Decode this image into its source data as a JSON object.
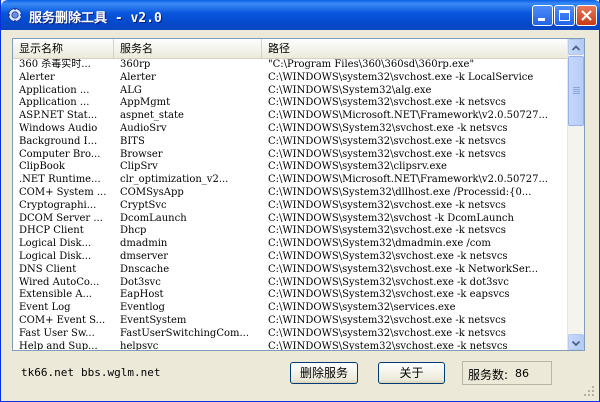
{
  "window": {
    "title": "服务删除工具 - v2.0"
  },
  "columns": [
    "显示名称",
    "服务名",
    "路径"
  ],
  "rows": [
    {
      "display": "360 杀毒实时...",
      "service": "360rp",
      "path": "\"C:\\Program Files\\360\\360sd\\360rp.exe\""
    },
    {
      "display": "Alerter",
      "service": "Alerter",
      "path": "C:\\WINDOWS\\system32\\svchost.exe -k LocalService"
    },
    {
      "display": "Application ...",
      "service": "ALG",
      "path": "C:\\WINDOWS\\System32\\alg.exe"
    },
    {
      "display": "Application ...",
      "service": "AppMgmt",
      "path": "C:\\WINDOWS\\system32\\svchost.exe -k netsvcs"
    },
    {
      "display": "ASP.NET Stat...",
      "service": "aspnet_state",
      "path": "C:\\WINDOWS\\Microsoft.NET\\Framework\\v2.0.50727..."
    },
    {
      "display": "Windows Audio",
      "service": "AudioSrv",
      "path": "C:\\WINDOWS\\System32\\svchost.exe -k netsvcs"
    },
    {
      "display": "Background I...",
      "service": "BITS",
      "path": "C:\\WINDOWS\\system32\\svchost.exe -k netsvcs"
    },
    {
      "display": "Computer Bro...",
      "service": "Browser",
      "path": "C:\\WINDOWS\\system32\\svchost.exe -k netsvcs"
    },
    {
      "display": "ClipBook",
      "service": "ClipSrv",
      "path": "C:\\WINDOWS\\system32\\clipsrv.exe"
    },
    {
      "display": ".NET Runtime...",
      "service": "clr_optimization_v2...",
      "path": "C:\\WINDOWS\\Microsoft.NET\\Framework\\v2.0.50727..."
    },
    {
      "display": "COM+ System ...",
      "service": "COMSysApp",
      "path": "C:\\WINDOWS\\System32\\dllhost.exe /Processid:{0..."
    },
    {
      "display": "Cryptographi...",
      "service": "CryptSvc",
      "path": "C:\\WINDOWS\\system32\\svchost.exe -k netsvcs"
    },
    {
      "display": "DCOM Server ...",
      "service": "DcomLaunch",
      "path": "C:\\WINDOWS\\system32\\svchost -k DcomLaunch"
    },
    {
      "display": "DHCP Client",
      "service": "Dhcp",
      "path": "C:\\WINDOWS\\system32\\svchost.exe -k netsvcs"
    },
    {
      "display": "Logical Disk...",
      "service": "dmadmin",
      "path": "C:\\WINDOWS\\System32\\dmadmin.exe /com"
    },
    {
      "display": "Logical Disk...",
      "service": "dmserver",
      "path": "C:\\WINDOWS\\System32\\svchost.exe -k netsvcs"
    },
    {
      "display": "DNS Client",
      "service": "Dnscache",
      "path": "C:\\WINDOWS\\system32\\svchost.exe -k NetworkSer..."
    },
    {
      "display": "Wired AutoCo...",
      "service": "Dot3svc",
      "path": "C:\\WINDOWS\\System32\\svchost.exe -k dot3svc"
    },
    {
      "display": "Extensible A...",
      "service": "EapHost",
      "path": "C:\\WINDOWS\\System32\\svchost.exe -k eapsvcs"
    },
    {
      "display": "Event Log",
      "service": "Eventlog",
      "path": "C:\\WINDOWS\\system32\\services.exe"
    },
    {
      "display": "COM+ Event S...",
      "service": "EventSystem",
      "path": "C:\\WINDOWS\\system32\\svchost.exe -k netsvcs"
    },
    {
      "display": "Fast User Sw...",
      "service": "FastUserSwitchingCom...",
      "path": "C:\\WINDOWS\\system32\\svchost.exe -k netsvcs"
    },
    {
      "display": "Help and Sup...",
      "service": "helpsvc",
      "path": "C:\\WINDOWS\\System32\\svchost.exe -k netsvcs"
    }
  ],
  "footer": {
    "link1": "tk66.net",
    "link2": "bbs.wglm.net",
    "delete_button": "删除服务",
    "about_button": "关于",
    "count_label": "服务数:",
    "count_value": "86"
  }
}
